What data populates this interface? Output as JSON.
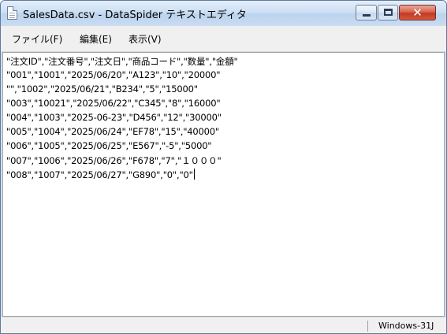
{
  "window": {
    "title": "SalesData.csv - DataSpider テキストエディタ",
    "controls": {
      "close_glyph": "✕"
    }
  },
  "menu": [
    {
      "label": "ファイル(F)"
    },
    {
      "label": "編集(E)"
    },
    {
      "label": "表示(V)"
    }
  ],
  "editor": {
    "lines": [
      "\"注文ID\",\"注文番号\",\"注文日\",\"商品コード\",\"数量\",\"金額\"",
      "\"001\",\"1001\",\"2025/06/20\",\"A123\",\"10\",\"20000\"",
      "\"\",\"1002\",\"2025/06/21\",\"B234\",\"5\",\"15000\"",
      "\"003\",\"10021\",\"2025/06/22\",\"C345\",\"8\",\"16000\"",
      "\"004\",\"1003\",\"2025-06-23\",\"D456\",\"12\",\"30000\"",
      "\"005\",\"1004\",\"2025/06/24\",\"EF78\",\"15\",\"40000\"",
      "\"006\",\"1005\",\"2025/06/25\",\"E567\",\"-5\",\"5000\"",
      "\"007\",\"1006\",\"2025/06/26\",\"F678\",\"7\",\"１０００\"",
      "\"008\",\"1007\",\"2025/06/27\",\"G890\",\"0\",\"0\""
    ]
  },
  "status": {
    "encoding": "Windows-31J"
  },
  "colors": {
    "titlebar": "#cddff4",
    "close_button": "#c23a22",
    "menubar": "#f0f0f0",
    "editor_bg": "#ffffff"
  },
  "icons": {
    "app": "notepad-document-icon",
    "minimize": "minimize-icon",
    "maximize": "maximize-icon",
    "close": "close-icon"
  }
}
